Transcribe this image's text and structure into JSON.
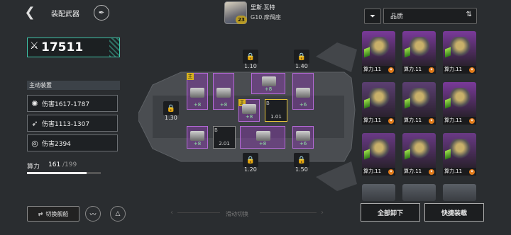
{
  "header": {
    "back_icon": "left-arrow-icon",
    "title": "装配武器",
    "feather_icon": "feather-icon",
    "pilot": {
      "level": "23",
      "name": "里斯.瓦特",
      "rank": "G10.摩羯座"
    },
    "filter_icon": "filter-icon",
    "quality_label": "品质",
    "quality_sort_icon": "sort-icon"
  },
  "left_panel": {
    "power_value": "17511",
    "section_title": "主动装置",
    "stats": [
      {
        "icon": "shotgun-icon",
        "text": "伤害1617-1787"
      },
      {
        "icon": "rocket-icon",
        "text": "伤害1113-1307"
      },
      {
        "icon": "target-icon",
        "text": "伤害2394"
      }
    ],
    "capacity_label": "算力",
    "capacity_used": "161",
    "capacity_total": "/199",
    "capacity_fraction": 0.809,
    "switch_ship": "切换舰船"
  },
  "ship": {
    "slots": [
      {
        "main": "主",
        "level": "+8"
      },
      {
        "main": "",
        "level": "+8"
      },
      {
        "main": "",
        "level": "+8"
      },
      {
        "main": "",
        "level": "+6"
      },
      {
        "main": "主",
        "level": "+8"
      },
      {
        "main": "",
        "level": "+8"
      },
      {
        "main": "",
        "level": "+8"
      },
      {
        "main": "",
        "level": "+6"
      }
    ],
    "dark_slots": [
      {
        "tag": "B",
        "value": "1.01"
      },
      {
        "tag": "B",
        "value": "2.01"
      }
    ],
    "locks": [
      "1.10",
      "1.40",
      "1.30",
      "1.20",
      "1.50"
    ],
    "swipe_hint": "滑动切换"
  },
  "inventory": {
    "items": [
      "算力.11",
      "算力.11",
      "算力.11",
      "算力.11",
      "算力.11",
      "算力.11",
      "算力.11",
      "算力.11",
      "算力.11"
    ],
    "unequip_all": "全部卸下",
    "quick_equip": "快捷装载"
  },
  "colors": {
    "accent": "#3fc4a8",
    "slot_purple": "#b56ad8",
    "level_green": "#8fe3a4",
    "main_gold": "#d9b31e"
  }
}
